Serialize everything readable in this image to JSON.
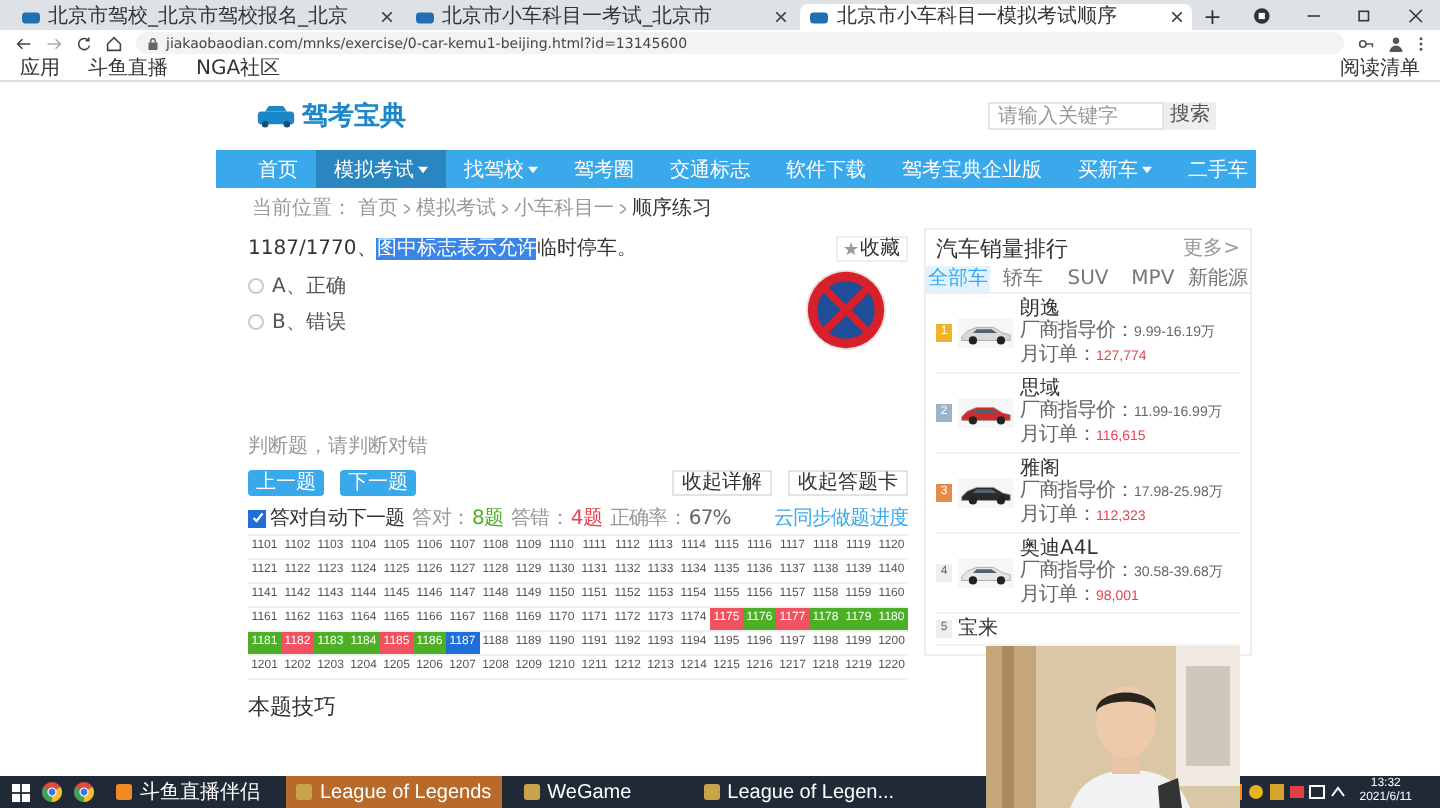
{
  "browser": {
    "tabs": [
      {
        "title": "北京市驾校_北京市驾校报名_北京",
        "selected": false
      },
      {
        "title": "北京市小车科目一考试_北京市",
        "selected": false
      },
      {
        "title": "北京市小车科目一模拟考试顺序",
        "selected": true
      }
    ],
    "new_tab": "+",
    "address": "jiakaobaodian.com/mnks/exercise/0-car-kemu1-beijing.html?id=13145600",
    "bookmarks": [
      "应用",
      "斗鱼直播",
      "NGA社区"
    ],
    "reading_list": "阅读清单"
  },
  "header": {
    "logo": "驾考宝典",
    "search": {
      "placeholder": "请输入关键字",
      "button": "搜索"
    }
  },
  "nav": [
    {
      "label": "首页",
      "dropdown": false,
      "selected": false
    },
    {
      "label": "模拟考试",
      "dropdown": true,
      "selected": true
    },
    {
      "label": "找驾校",
      "dropdown": true,
      "selected": false
    },
    {
      "label": "驾考圈",
      "dropdown": false,
      "selected": false
    },
    {
      "label": "交通标志",
      "dropdown": false,
      "selected": false
    },
    {
      "label": "软件下载",
      "dropdown": false,
      "selected": false
    },
    {
      "label": "驾考宝典企业版",
      "dropdown": false,
      "selected": false
    },
    {
      "label": "买新车",
      "dropdown": true,
      "selected": false
    },
    {
      "label": "二手车",
      "dropdown": false,
      "selected": false
    }
  ],
  "breadcrumb": {
    "prefix": "当前位置：",
    "items": [
      "首页",
      "模拟考试",
      "小车科目一",
      "顺序练习"
    ]
  },
  "question": {
    "number": "1187/1770、",
    "highlighted": "图中标志表示允许",
    "rest": "临时停车。",
    "favorite": "收藏",
    "options": [
      {
        "label": "A、正确",
        "selected": false
      },
      {
        "label": "B、错误",
        "selected": false
      }
    ],
    "hint": "判断题，请判断对错"
  },
  "buttons": {
    "prev": "上一题",
    "next": "下一题",
    "details": "收起详解",
    "card": "收起答题卡"
  },
  "answer_card": {
    "auto_next": {
      "label": "答对自动下一题",
      "checked": true
    },
    "right": {
      "label": "答对：",
      "value": "8题"
    },
    "wrong": {
      "label": "答错：",
      "value": "4题"
    },
    "accuracy": {
      "label": "正确率：",
      "value": "67%"
    },
    "sync": "云同步做题进度",
    "rows": [
      [
        {
          "n": "1101",
          "kind": "plain"
        },
        {
          "n": "1102",
          "kind": "plain"
        },
        {
          "n": "1103",
          "kind": "plain"
        },
        {
          "n": "1104",
          "kind": "plain"
        },
        {
          "n": "1105",
          "kind": "plain"
        },
        {
          "n": "1106",
          "kind": "plain"
        },
        {
          "n": "1107",
          "kind": "plain"
        },
        {
          "n": "1108",
          "kind": "plain"
        },
        {
          "n": "1109",
          "kind": "plain"
        },
        {
          "n": "1110",
          "kind": "plain"
        },
        {
          "n": "1111",
          "kind": "plain"
        },
        {
          "n": "1112",
          "kind": "plain"
        },
        {
          "n": "1113",
          "kind": "plain"
        },
        {
          "n": "1114",
          "kind": "plain"
        },
        {
          "n": "1115",
          "kind": "plain"
        },
        {
          "n": "1116",
          "kind": "plain"
        },
        {
          "n": "1117",
          "kind": "plain"
        },
        {
          "n": "1118",
          "kind": "plain"
        },
        {
          "n": "1119",
          "kind": "plain"
        },
        {
          "n": "1120",
          "kind": "plain"
        }
      ],
      [
        {
          "n": "1121",
          "kind": "plain"
        },
        {
          "n": "1122",
          "kind": "plain"
        },
        {
          "n": "1123",
          "kind": "plain"
        },
        {
          "n": "1124",
          "kind": "plain"
        },
        {
          "n": "1125",
          "kind": "plain"
        },
        {
          "n": "1126",
          "kind": "plain"
        },
        {
          "n": "1127",
          "kind": "plain"
        },
        {
          "n": "1128",
          "kind": "plain"
        },
        {
          "n": "1129",
          "kind": "plain"
        },
        {
          "n": "1130",
          "kind": "plain"
        },
        {
          "n": "1131",
          "kind": "plain"
        },
        {
          "n": "1132",
          "kind": "plain"
        },
        {
          "n": "1133",
          "kind": "plain"
        },
        {
          "n": "1134",
          "kind": "plain"
        },
        {
          "n": "1135",
          "kind": "plain"
        },
        {
          "n": "1136",
          "kind": "plain"
        },
        {
          "n": "1137",
          "kind": "plain"
        },
        {
          "n": "1138",
          "kind": "plain"
        },
        {
          "n": "1139",
          "kind": "plain"
        },
        {
          "n": "1140",
          "kind": "plain"
        }
      ],
      [
        {
          "n": "1141",
          "kind": "plain"
        },
        {
          "n": "1142",
          "kind": "plain"
        },
        {
          "n": "1143",
          "kind": "plain"
        },
        {
          "n": "1144",
          "kind": "plain"
        },
        {
          "n": "1145",
          "kind": "plain"
        },
        {
          "n": "1146",
          "kind": "plain"
        },
        {
          "n": "1147",
          "kind": "plain"
        },
        {
          "n": "1148",
          "kind": "plain"
        },
        {
          "n": "1149",
          "kind": "plain"
        },
        {
          "n": "1150",
          "kind": "plain"
        },
        {
          "n": "1151",
          "kind": "plain"
        },
        {
          "n": "1152",
          "kind": "plain"
        },
        {
          "n": "1153",
          "kind": "plain"
        },
        {
          "n": "1154",
          "kind": "plain"
        },
        {
          "n": "1155",
          "kind": "plain"
        },
        {
          "n": "1156",
          "kind": "plain"
        },
        {
          "n": "1157",
          "kind": "plain"
        },
        {
          "n": "1158",
          "kind": "plain"
        },
        {
          "n": "1159",
          "kind": "plain"
        },
        {
          "n": "1160",
          "kind": "plain"
        }
      ],
      [
        {
          "n": "1161",
          "kind": "plain"
        },
        {
          "n": "1162",
          "kind": "plain"
        },
        {
          "n": "1163",
          "kind": "plain"
        },
        {
          "n": "1164",
          "kind": "plain"
        },
        {
          "n": "1165",
          "kind": "plain"
        },
        {
          "n": "1166",
          "kind": "plain"
        },
        {
          "n": "1167",
          "kind": "plain"
        },
        {
          "n": "1168",
          "kind": "plain"
        },
        {
          "n": "1169",
          "kind": "plain"
        },
        {
          "n": "1170",
          "kind": "plain"
        },
        {
          "n": "1171",
          "kind": "plain"
        },
        {
          "n": "1172",
          "kind": "plain"
        },
        {
          "n": "1173",
          "kind": "plain"
        },
        {
          "n": "1174",
          "kind": "plain"
        },
        {
          "n": "1175",
          "kind": "wrong"
        },
        {
          "n": "1176",
          "kind": "right"
        },
        {
          "n": "1177",
          "kind": "wrong"
        },
        {
          "n": "1178",
          "kind": "right"
        },
        {
          "n": "1179",
          "kind": "right"
        },
        {
          "n": "1180",
          "kind": "right"
        }
      ],
      [
        {
          "n": "1181",
          "kind": "right"
        },
        {
          "n": "1182",
          "kind": "wrong"
        },
        {
          "n": "1183",
          "kind": "right"
        },
        {
          "n": "1184",
          "kind": "right"
        },
        {
          "n": "1185",
          "kind": "wrong"
        },
        {
          "n": "1186",
          "kind": "right"
        },
        {
          "n": "1187",
          "kind": "current"
        },
        {
          "n": "1188",
          "kind": "plain"
        },
        {
          "n": "1189",
          "kind": "plain"
        },
        {
          "n": "1190",
          "kind": "plain"
        },
        {
          "n": "1191",
          "kind": "plain"
        },
        {
          "n": "1192",
          "kind": "plain"
        },
        {
          "n": "1193",
          "kind": "plain"
        },
        {
          "n": "1194",
          "kind": "plain"
        },
        {
          "n": "1195",
          "kind": "plain"
        },
        {
          "n": "1196",
          "kind": "plain"
        },
        {
          "n": "1197",
          "kind": "plain"
        },
        {
          "n": "1198",
          "kind": "plain"
        },
        {
          "n": "1199",
          "kind": "plain"
        },
        {
          "n": "1200",
          "kind": "plain"
        }
      ],
      [
        {
          "n": "1201",
          "kind": "plain"
        },
        {
          "n": "1202",
          "kind": "plain"
        },
        {
          "n": "1203",
          "kind": "plain"
        },
        {
          "n": "1204",
          "kind": "plain"
        },
        {
          "n": "1205",
          "kind": "plain"
        },
        {
          "n": "1206",
          "kind": "plain"
        },
        {
          "n": "1207",
          "kind": "plain"
        },
        {
          "n": "1208",
          "kind": "plain"
        },
        {
          "n": "1209",
          "kind": "plain"
        },
        {
          "n": "1210",
          "kind": "plain"
        },
        {
          "n": "1211",
          "kind": "plain"
        },
        {
          "n": "1212",
          "kind": "plain"
        },
        {
          "n": "1213",
          "kind": "plain"
        },
        {
          "n": "1214",
          "kind": "plain"
        },
        {
          "n": "1215",
          "kind": "plain"
        },
        {
          "n": "1216",
          "kind": "plain"
        },
        {
          "n": "1217",
          "kind": "plain"
        },
        {
          "n": "1218",
          "kind": "plain"
        },
        {
          "n": "1219",
          "kind": "plain"
        },
        {
          "n": "1220",
          "kind": "plain"
        }
      ]
    ]
  },
  "tips_title": "本题技巧",
  "sidebar": {
    "title": "汽车销量排行",
    "more": "更多>",
    "tabs": [
      {
        "label": "全部车",
        "selected": true
      },
      {
        "label": "轿车",
        "selected": false
      },
      {
        "label": "SUV",
        "selected": false
      },
      {
        "label": "MPV",
        "selected": false
      },
      {
        "label": "新能源",
        "selected": false
      }
    ],
    "cars": [
      {
        "rank": "1",
        "name": "朗逸",
        "price_label": "厂商指导价：",
        "price": "9.99-16.19万",
        "orders_label": "月订单：",
        "orders": "127,774",
        "color": "#f0b429"
      },
      {
        "rank": "2",
        "name": "思域",
        "price_label": "厂商指导价：",
        "price": "11.99-16.99万",
        "orders_label": "月订单：",
        "orders": "116,615",
        "color": "#9db3cc"
      },
      {
        "rank": "3",
        "name": "雅阁",
        "price_label": "厂商指导价：",
        "price": "17.98-25.98万",
        "orders_label": "月订单：",
        "orders": "112,323",
        "color": "#e8894a"
      },
      {
        "rank": "4",
        "name": "奥迪A4L",
        "price_label": "厂商指导价：",
        "price": "30.58-39.68万",
        "orders_label": "月订单：",
        "orders": "98,001",
        "color": "#eeeeee"
      }
    ],
    "partial_car": {
      "rank": "5",
      "name": "宝来"
    }
  },
  "taskbar": {
    "items": [
      {
        "label": "斗鱼直播伴侣",
        "selected": false
      },
      {
        "label": "League of Legends",
        "selected": true
      },
      {
        "label": "WeGame",
        "selected": false
      },
      {
        "label": "League of Legen...",
        "selected": false
      }
    ],
    "time": "13:32",
    "date": "2021/6/11"
  }
}
